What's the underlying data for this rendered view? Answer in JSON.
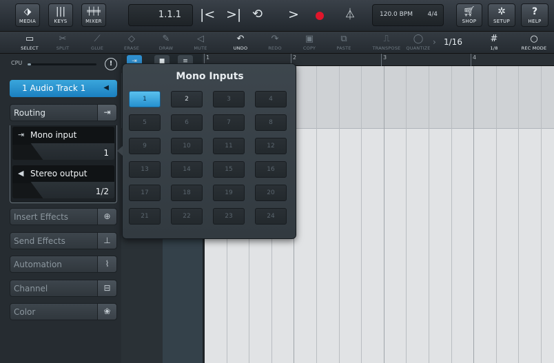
{
  "topbar": {
    "media": "MEDIA",
    "keys": "KEYS",
    "mixer": "MIXER",
    "position": "1.1.1",
    "tempo": "120.0 BPM",
    "signature": "4/4",
    "shop": "SHOP",
    "setup": "SETUP",
    "help": "HELP"
  },
  "tools": {
    "select": "SELECT",
    "split": "SPLIT",
    "glue": "GLUE",
    "erase": "ERASE",
    "draw": "DRAW",
    "mute": "MUTE",
    "undo": "UNDO",
    "redo": "REDO",
    "copy": "COPY",
    "paste": "PASTE",
    "transpose": "TRANSPOSE",
    "quantize": "QUANTIZE",
    "quantize_value": "1/16",
    "grid": "1/8",
    "rec_mode": "REC MODE"
  },
  "inspector": {
    "cpu_label": "CPU",
    "cpu_load": 0.05,
    "track_name": "1 Audio Track 1",
    "routing": "Routing",
    "input_label": "Mono input",
    "input_value": "1",
    "output_label": "Stereo output",
    "output_value": "1/2",
    "sections": [
      "Insert Effects",
      "Send Effects",
      "Automation",
      "Channel",
      "Color"
    ]
  },
  "ruler": {
    "bar2": "2",
    "bar3": "3",
    "bar4": "4",
    "bar1": "1"
  },
  "popup": {
    "title": "Mono Inputs",
    "selected": "1",
    "channels": [
      "1",
      "2",
      "3",
      "4",
      "5",
      "6",
      "7",
      "8",
      "9",
      "10",
      "11",
      "12",
      "13",
      "14",
      "15",
      "16",
      "17",
      "18",
      "19",
      "20",
      "21",
      "22",
      "23",
      "24"
    ],
    "available": [
      "1",
      "2"
    ]
  },
  "colors": {
    "accent": "#2a94d3",
    "record": "#e0162b"
  }
}
